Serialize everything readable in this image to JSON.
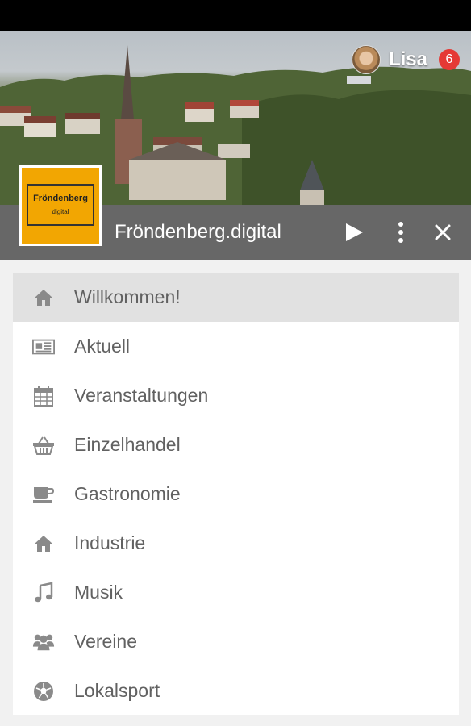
{
  "user": {
    "name": "Lisa",
    "notification_count": "6"
  },
  "app": {
    "title": "Fröndenberg.digital",
    "logo_title": "Fröndenberg",
    "logo_subtitle": "digital"
  },
  "menu": [
    {
      "label": "Willkommen!",
      "icon": "home-icon",
      "active": true
    },
    {
      "label": "Aktuell",
      "icon": "newspaper-icon"
    },
    {
      "label": "Veranstaltungen",
      "icon": "calendar-icon"
    },
    {
      "label": "Einzelhandel",
      "icon": "basket-icon"
    },
    {
      "label": "Gastronomie",
      "icon": "coffee-icon"
    },
    {
      "label": "Industrie",
      "icon": "home-icon"
    },
    {
      "label": "Musik",
      "icon": "music-icon"
    },
    {
      "label": "Vereine",
      "icon": "group-icon"
    },
    {
      "label": "Lokalsport",
      "icon": "soccer-ball-icon"
    }
  ],
  "colors": {
    "appbar": "#676767",
    "logo": "#f2a602",
    "badge": "#e53935",
    "active_item": "#e1e1e1",
    "icon": "#8a8a8a",
    "text": "#616161"
  }
}
